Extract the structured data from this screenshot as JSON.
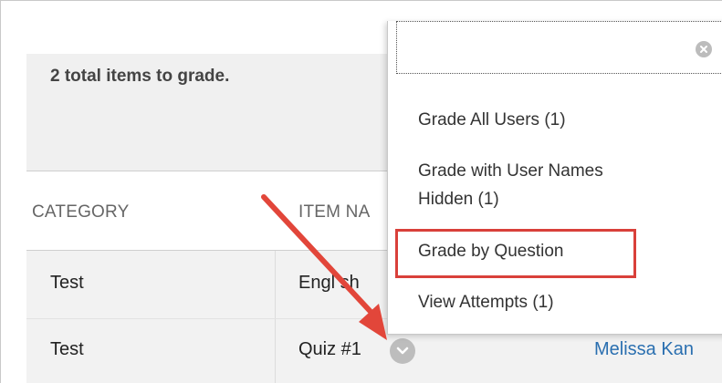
{
  "summary": {
    "text": "2 total items to grade."
  },
  "table": {
    "headers": {
      "category": "CATEGORY",
      "item_name": "ITEM NA"
    },
    "rows": [
      {
        "category": "Test",
        "item_name": "Engl sh "
      },
      {
        "category": "Test",
        "item_name": "Quiz #1",
        "user": "Melissa Kan"
      }
    ]
  },
  "dropdown": {
    "search_value": "",
    "items": [
      "Grade All Users (1)",
      "Grade with User Names",
      "Hidden (1)",
      "Grade by Question",
      "View Attempts (1)"
    ]
  },
  "colors": {
    "highlight": "#d9403a",
    "arrow": "#e2463a",
    "link": "#2a6fb0"
  },
  "icons": {
    "row_menu": "chevron-down-icon",
    "search_clear": "clear-icon"
  }
}
